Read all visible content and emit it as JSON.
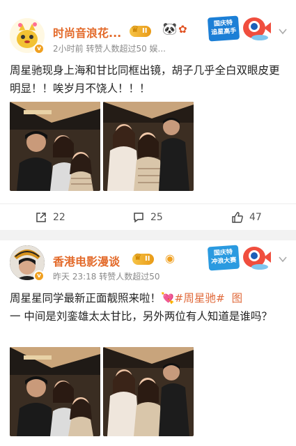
{
  "posts": [
    {
      "user_name": "时尚音浪花...",
      "vip_level": "II",
      "meta": "2小时前  转赞人数超过50   娱...",
      "text": "周星驰现身上海和甘比同框出镜，胡子几乎全白双眼皮更明显！！唉岁月不饶人！！！",
      "promo_line1": "国庆特",
      "promo_line2": "追星高手",
      "actions": {
        "repost": "22",
        "comment": "25",
        "like": "47"
      }
    },
    {
      "user_name": "香港电影漫谈",
      "vip_level": "II",
      "meta": "昨天 23:18  转赞人数超过50",
      "text_main": "周星星同学最新正面靓照来啦！",
      "text_hashtag": "#周星驰#",
      "text_link": "图",
      "text_rest": "一 中间是刘銮雄太太甘比，另外两位有人知道是谁吗？",
      "promo_line1": "国庆特",
      "promo_line2": "冲浪大赛"
    }
  ],
  "colors": {
    "accent": "#e36a2a",
    "link": "#e0693a",
    "vip": "#f6c447"
  }
}
